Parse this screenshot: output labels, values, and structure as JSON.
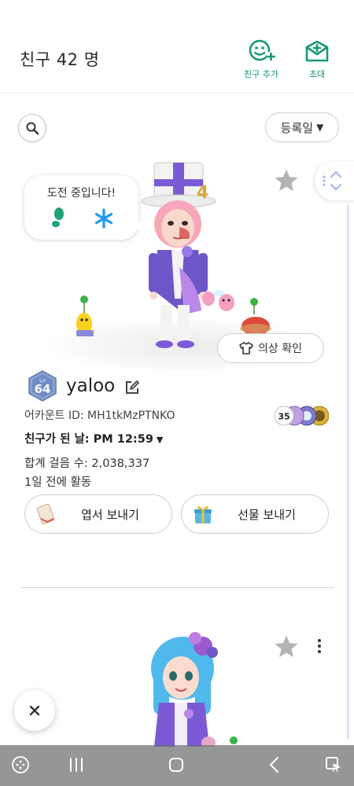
{
  "header": {
    "title": "친구 42 명",
    "add_friend_label": "친구 추가",
    "invite_label": "초대"
  },
  "toolbar": {
    "sort_label": "등록일"
  },
  "friend": {
    "speech_bubble": "도전 중입니다!",
    "outfit_button": "의상 확인",
    "level": "64",
    "level_prefix": "Lv",
    "username": "yaloo",
    "account_id": "어카운트 ID: MH1tkMzPTNKO",
    "friend_since": "친구가 된 날: PM 12:59",
    "total_steps": "합계 걸음 수: 2,038,337",
    "last_active": "1일 전에 활동",
    "medal_count": "35",
    "send_postcard": "엽서 보내기",
    "send_gift": "선물 보내기"
  },
  "colors": {
    "accent_green": "#159a6a",
    "star_gray": "#b3b3b3",
    "outfit_purple": "#6e55c8"
  }
}
